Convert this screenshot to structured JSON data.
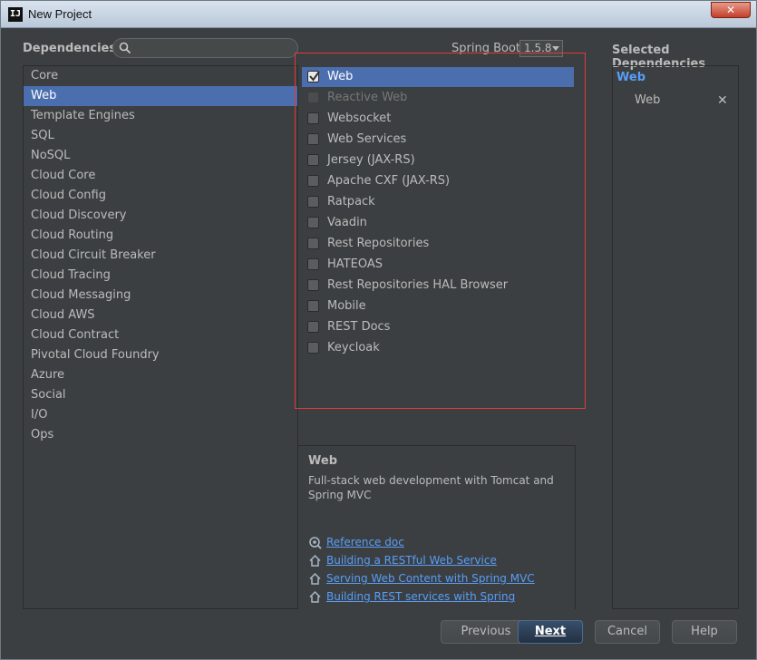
{
  "window": {
    "title": "New Project",
    "app_icon": "IJ",
    "close_glyph": "✕"
  },
  "header": {
    "dependencies_label": "Dependencies",
    "search_placeholder": "",
    "spring_boot_label": "Spring Boot",
    "spring_boot_version": "1.5.8",
    "selected_label": "Selected Dependencies"
  },
  "categories": [
    "Core",
    "Web",
    "Template Engines",
    "SQL",
    "NoSQL",
    "Cloud Core",
    "Cloud Config",
    "Cloud Discovery",
    "Cloud Routing",
    "Cloud Circuit Breaker",
    "Cloud Tracing",
    "Cloud Messaging",
    "Cloud AWS",
    "Cloud Contract",
    "Pivotal Cloud Foundry",
    "Azure",
    "Social",
    "I/O",
    "Ops"
  ],
  "selected_category_index": 1,
  "dependencies": [
    {
      "label": "Web",
      "checked": true,
      "enabled": true
    },
    {
      "label": "Reactive Web",
      "checked": false,
      "enabled": false
    },
    {
      "label": "Websocket",
      "checked": false,
      "enabled": true
    },
    {
      "label": "Web Services",
      "checked": false,
      "enabled": true
    },
    {
      "label": "Jersey (JAX-RS)",
      "checked": false,
      "enabled": true
    },
    {
      "label": "Apache CXF (JAX-RS)",
      "checked": false,
      "enabled": true
    },
    {
      "label": "Ratpack",
      "checked": false,
      "enabled": true
    },
    {
      "label": "Vaadin",
      "checked": false,
      "enabled": true
    },
    {
      "label": "Rest Repositories",
      "checked": false,
      "enabled": true
    },
    {
      "label": "HATEOAS",
      "checked": false,
      "enabled": true
    },
    {
      "label": "Rest Repositories HAL Browser",
      "checked": false,
      "enabled": true
    },
    {
      "label": "Mobile",
      "checked": false,
      "enabled": true
    },
    {
      "label": "REST Docs",
      "checked": false,
      "enabled": true
    },
    {
      "label": "Keycloak",
      "checked": false,
      "enabled": true
    }
  ],
  "selected_dependency_index": 0,
  "description": {
    "title": "Web",
    "text": "Full-stack web development with Tomcat and Spring MVC"
  },
  "links": [
    {
      "label": "Reference doc",
      "icon": "reference-doc-icon"
    },
    {
      "label": "Building a RESTful Web Service",
      "icon": "guide-home-icon"
    },
    {
      "label": "Serving Web Content with Spring MVC",
      "icon": "guide-home-icon"
    },
    {
      "label": "Building REST services with Spring",
      "icon": "guide-home-icon"
    }
  ],
  "selected_dependencies": {
    "group": "Web",
    "items": [
      {
        "label": "Web",
        "remove_glyph": "✕"
      }
    ]
  },
  "buttons": {
    "previous": "Previous",
    "next": "Next",
    "cancel": "Cancel",
    "help": "Help"
  },
  "colors": {
    "accent": "#4b6eaf",
    "link": "#589df6",
    "highlight_box": "#e0393c",
    "background": "#3c3f41"
  }
}
